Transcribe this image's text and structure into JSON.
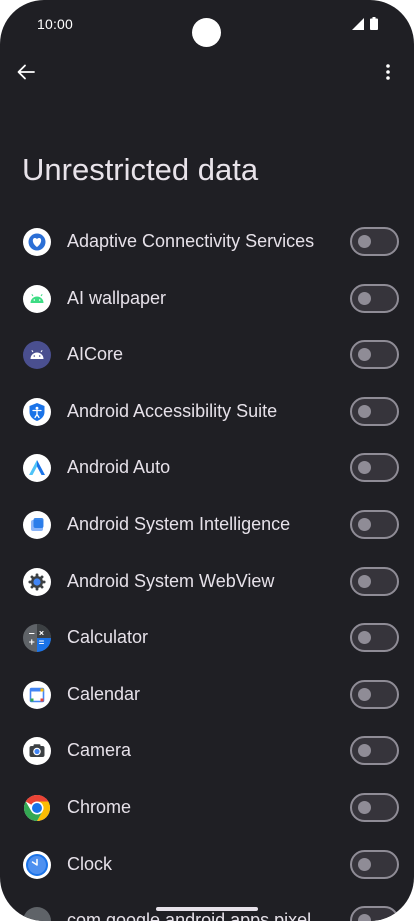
{
  "status_bar": {
    "time": "10:00"
  },
  "app_bar": {
    "back_icon": "arrow-back-icon",
    "more_icon": "more-vert-icon"
  },
  "page": {
    "title": "Unrestricted data"
  },
  "colors": {
    "background": "#1f1f24",
    "toggle_off_track": "#36343b",
    "toggle_off_outline": "#8f8c96"
  },
  "apps": [
    {
      "label": "Adaptive Connectivity Services",
      "icon": "adaptive-connectivity-icon",
      "enabled": false
    },
    {
      "label": "AI wallpaper",
      "icon": "android-robot-icon",
      "enabled": false
    },
    {
      "label": "AICore",
      "icon": "aicore-icon",
      "enabled": false
    },
    {
      "label": "Android Accessibility Suite",
      "icon": "accessibility-icon",
      "enabled": false
    },
    {
      "label": "Android Auto",
      "icon": "android-auto-icon",
      "enabled": false
    },
    {
      "label": "Android System Intelligence",
      "icon": "system-intelligence-icon",
      "enabled": false
    },
    {
      "label": "Android System WebView",
      "icon": "webview-gear-icon",
      "enabled": false
    },
    {
      "label": "Calculator",
      "icon": "calculator-icon",
      "enabled": false
    },
    {
      "label": "Calendar",
      "icon": "calendar-icon",
      "enabled": false
    },
    {
      "label": "Camera",
      "icon": "camera-icon",
      "enabled": false
    },
    {
      "label": "Chrome",
      "icon": "chrome-icon",
      "enabled": false
    },
    {
      "label": "Clock",
      "icon": "clock-icon",
      "enabled": false
    },
    {
      "label": "com.google.android.apps.pixel",
      "icon": "generic-app-icon",
      "enabled": false
    }
  ]
}
